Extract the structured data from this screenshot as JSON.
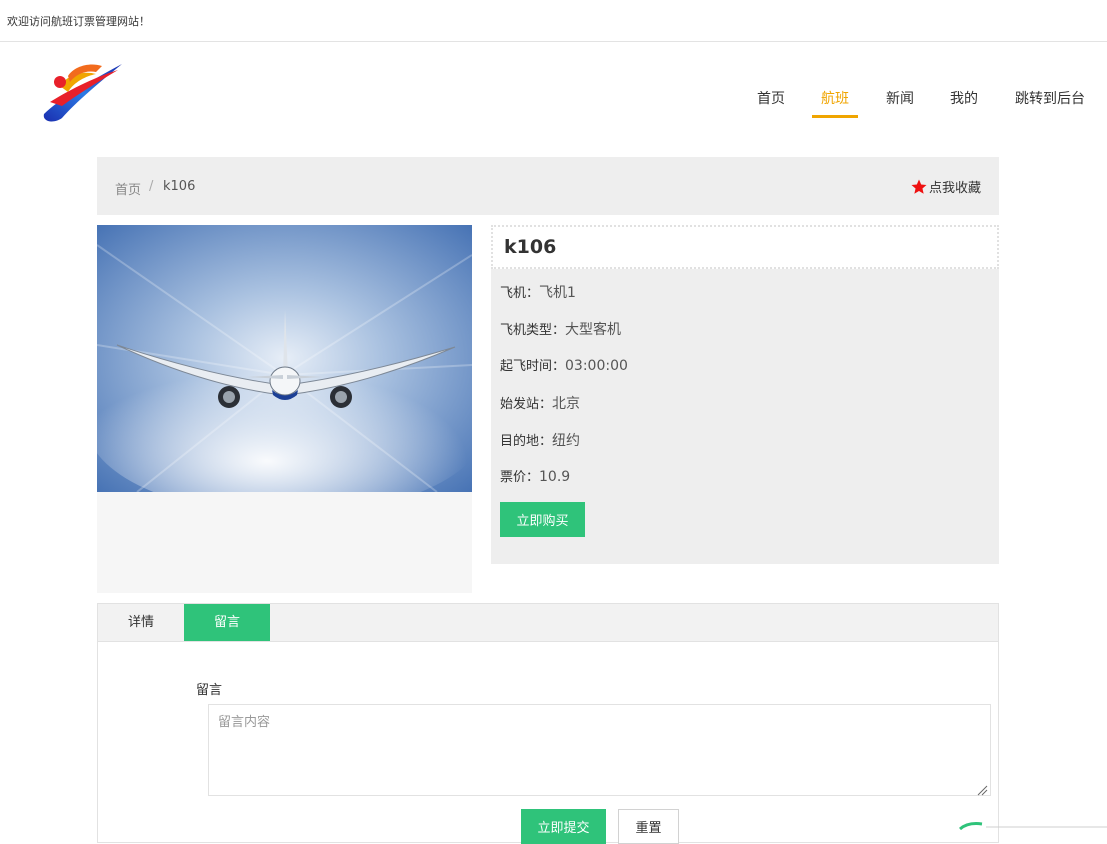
{
  "header": {
    "welcome": "欢迎访问航班订票管理网站！"
  },
  "nav": {
    "items": [
      {
        "label": "首页"
      },
      {
        "label": "航班",
        "active": true
      },
      {
        "label": "新闻"
      },
      {
        "label": "我的"
      },
      {
        "label": "跳转到后台"
      }
    ]
  },
  "breadcrumb": {
    "home": "首页",
    "separator": "/",
    "current": "k106"
  },
  "favorite": {
    "label": "点我收藏",
    "icon": "star-icon"
  },
  "flight": {
    "title": "k106",
    "fields": [
      {
        "label": "飞机：",
        "value": "飞机1"
      },
      {
        "label": "飞机类型：",
        "value": "大型客机"
      },
      {
        "label": "起飞时间：",
        "value": "03:00:00"
      },
      {
        "label": "始发站：",
        "value": "北京"
      },
      {
        "label": "目的地：",
        "value": "纽约"
      },
      {
        "label": "票价：",
        "value": "10.9"
      }
    ],
    "buy_label": "立即购买"
  },
  "tabs": {
    "items": [
      {
        "label": "详情"
      },
      {
        "label": "留言",
        "active": true
      }
    ]
  },
  "comment_form": {
    "label": "留言",
    "placeholder": "留言内容",
    "submit_label": "立即提交",
    "reset_label": "重置"
  },
  "colors": {
    "accent": "#f0a500",
    "primary_button": "#2fc37a",
    "panel_bg": "#eeeeee"
  }
}
